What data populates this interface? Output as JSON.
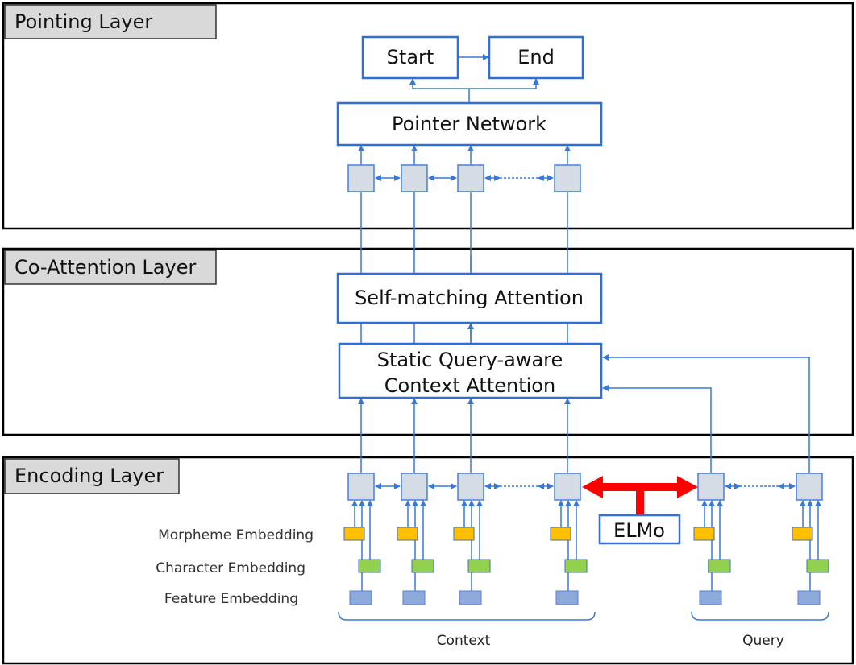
{
  "layers": {
    "pointing": "Pointing Layer",
    "coattention": "Co-Attention Layer",
    "encoding": "Encoding Layer"
  },
  "boxes": {
    "start": "Start",
    "end": "End",
    "pointer_network": "Pointer Network",
    "self_matching": "Self-matching Attention",
    "static_line1": "Static Query-aware",
    "static_line2": "Context Attention",
    "elmo": "ELMo"
  },
  "embeddings": {
    "morpheme": "Morpheme Embedding",
    "character": "Character Embedding",
    "feature": "Feature Embedding"
  },
  "groups": {
    "context": "Context",
    "query": "Query"
  },
  "colors": {
    "morpheme": "#ffc000",
    "character": "#92d050",
    "feature": "#8eaadb",
    "hidden": "#d6dce5",
    "arrow": "#3a78d8",
    "elmo_arrow": "#ff0000"
  }
}
